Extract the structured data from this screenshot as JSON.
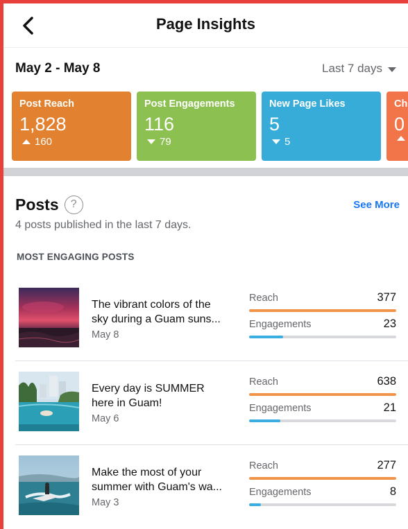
{
  "header": {
    "title": "Page Insights",
    "back_icon": "chevron-left-icon"
  },
  "date_row": {
    "range": "May 2 - May 8",
    "period": "Last 7 days"
  },
  "metrics": [
    {
      "label": "Post Reach",
      "value": "1,828",
      "change": "160",
      "direction": "up",
      "color": "#e2812f"
    },
    {
      "label": "Post Engagements",
      "value": "116",
      "change": "79",
      "direction": "down",
      "color": "#8cc152"
    },
    {
      "label": "New Page Likes",
      "value": "5",
      "change": "5",
      "direction": "down",
      "color": "#38acd9"
    },
    {
      "label": "Ch",
      "value": "0",
      "change": "",
      "direction": "up",
      "color": "#f2754a"
    }
  ],
  "posts": {
    "title": "Posts",
    "see_more": "See More",
    "subtitle": "4 posts published in the last 7 days.",
    "section_label": "MOST ENGAGING POSTS",
    "reach_label": "Reach",
    "engagements_label": "Engagements",
    "reach_color": "#f0944a",
    "engagement_color": "#3aaee0",
    "items": [
      {
        "caption_line1": "The vibrant colors of the",
        "caption_line2": "sky during a Guam suns...",
        "date": "May 8",
        "reach": "377",
        "engagements": "23",
        "reach_fraction": 1.0,
        "engagement_fraction": 0.23,
        "thumb": "sunset"
      },
      {
        "caption_line1": "Every day is SUMMER",
        "caption_line2": "here in Guam!",
        "date": "May 6",
        "reach": "638",
        "engagements": "21",
        "reach_fraction": 1.0,
        "engagement_fraction": 0.21,
        "thumb": "pool"
      },
      {
        "caption_line1": "Make the most of your",
        "caption_line2": "summer with Guam's wa...",
        "date": "May 3",
        "reach": "277",
        "engagements": "8",
        "reach_fraction": 1.0,
        "engagement_fraction": 0.08,
        "thumb": "jetski"
      }
    ]
  }
}
